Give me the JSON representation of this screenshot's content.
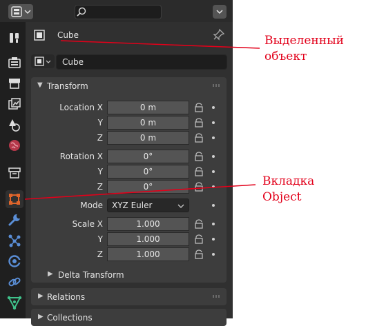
{
  "context": {
    "object_name": "Cube"
  },
  "name_field": {
    "value": "Cube"
  },
  "transform": {
    "title": "Transform",
    "location": {
      "label": "Location X",
      "y_label": "Y",
      "z_label": "Z",
      "values": [
        "0 m",
        "0 m",
        "0 m"
      ]
    },
    "rotation": {
      "label": "Rotation X",
      "y_label": "Y",
      "z_label": "Z",
      "values": [
        "0°",
        "0°",
        "0°"
      ]
    },
    "mode": {
      "label": "Mode",
      "value": "XYZ Euler"
    },
    "scale": {
      "label": "Scale X",
      "y_label": "Y",
      "z_label": "Z",
      "values": [
        "1.000",
        "1.000",
        "1.000"
      ]
    },
    "delta": "Delta Transform"
  },
  "sections": {
    "relations": "Relations",
    "collections": "Collections"
  },
  "annotations": {
    "selected_object": [
      "Выделенный",
      "объект"
    ],
    "object_tab": [
      "Вкладка",
      "Object"
    ]
  },
  "colors": {
    "annotation": "#e2001a",
    "active_tab": "#e0652b"
  },
  "icons": [
    "editor-type-icon",
    "search-icon",
    "chevron-down-icon",
    "tool-icon",
    "render-icon",
    "output-icon",
    "view-layer-icon",
    "scene-icon",
    "world-icon",
    "collection-icon",
    "object-icon",
    "modifier-icon",
    "particles-icon",
    "physics-icon",
    "constraints-icon",
    "data-icon",
    "pin-icon",
    "lock-icon"
  ]
}
